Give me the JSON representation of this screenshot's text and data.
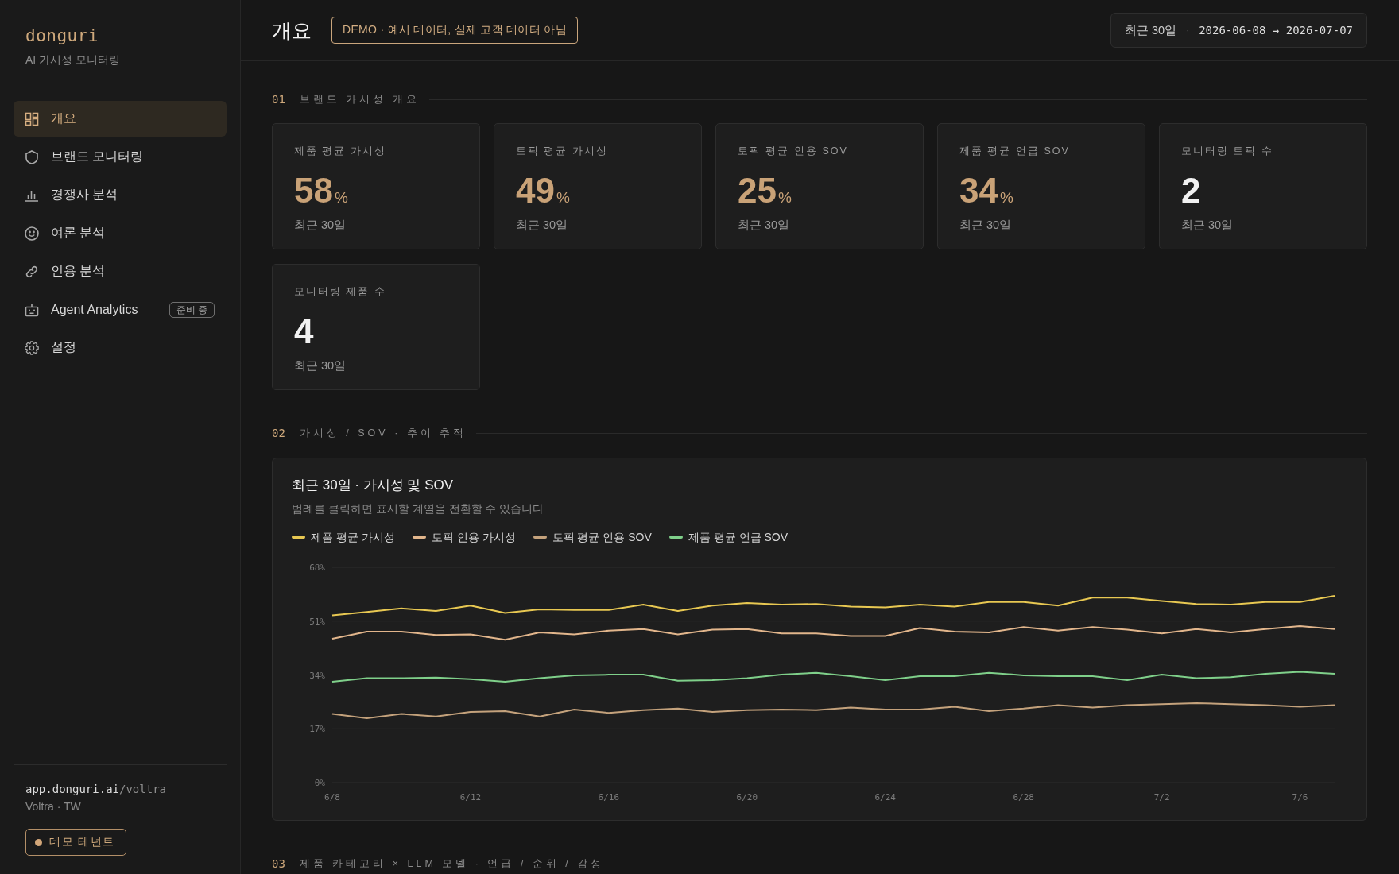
{
  "sidebar": {
    "logo": "donguri",
    "subtitle": "AI 가시성 모니터링",
    "nav_items": [
      {
        "label": "개요",
        "selected": true
      },
      {
        "label": "브랜드 모니터링",
        "selected": false
      },
      {
        "label": "경쟁사 분석",
        "selected": false
      },
      {
        "label": "여론 분석",
        "selected": false
      },
      {
        "label": "인용 분석",
        "selected": false
      },
      {
        "label": "Agent Analytics",
        "selected": false,
        "badge": "준비 중"
      },
      {
        "label": "설정",
        "selected": false
      }
    ],
    "footer": {
      "url_host": "app.donguri.ai",
      "url_path": "/voltra",
      "tenant": "Voltra · TW",
      "tenant_button": "데모 테넌트"
    }
  },
  "header": {
    "title": "개요",
    "demo_badge": "DEMO · 예시 데이터, 실제 고객 데이터 아님",
    "date_range": {
      "period": "최근 30일",
      "separator": "·",
      "range": "2026-06-08 → 2026-07-07"
    }
  },
  "sections": [
    {
      "number": "01",
      "title": "브랜드 가시성 개요",
      "metrics": [
        {
          "label": "제품 평균 가시성",
          "kind": "percent",
          "value": "58",
          "unit": "%",
          "caption": "최근 30일"
        },
        {
          "label": "토픽 평균 가시성",
          "kind": "percent",
          "value": "49",
          "unit": "%",
          "caption": "최근 30일"
        },
        {
          "label": "토픽 평균 인용 SOV",
          "kind": "percent",
          "value": "25",
          "unit": "%",
          "caption": "최근 30일"
        },
        {
          "label": "제품 평균 언급 SOV",
          "kind": "percent",
          "value": "34",
          "unit": "%",
          "caption": "최근 30일"
        },
        {
          "label": "모니터링 토픽 수",
          "kind": "count",
          "value": "2",
          "caption": "최근 30일"
        },
        {
          "label": "모니터링 제품 수",
          "kind": "count",
          "value": "4",
          "caption": "최근 30일"
        }
      ]
    },
    {
      "number": "02",
      "title": "가시성 / SOV · 추이 추적",
      "chart": {
        "hint": "범례를 클릭하면 표시할 계열을 전환할 수 있습니다",
        "chart_data": {
          "type": "line",
          "title": "최근 30일 · 가시성 및 SOV",
          "grid": true,
          "categories": [
            "6/8",
            null,
            null,
            null,
            "6/12",
            null,
            null,
            null,
            "6/16",
            null,
            null,
            null,
            "6/20",
            null,
            null,
            null,
            "6/24",
            null,
            null,
            null,
            "6/28",
            null,
            null,
            null,
            "7/2",
            null,
            null,
            null,
            "7/6",
            null
          ],
          "ylim": [
            0,
            68
          ],
          "yticks": [
            {
              "value": 0,
              "label": "0%"
            },
            {
              "value": 17,
              "label": "17%"
            },
            {
              "value": 34,
              "label": "34%"
            },
            {
              "value": 51,
              "label": "51%"
            },
            {
              "value": 68,
              "label": "68%"
            }
          ],
          "series": [
            {
              "name": "제품 평균 가시성",
              "color": "#e8c852",
              "values": [
                52.8,
                53.9,
                55.0,
                54.2,
                55.9,
                53.6,
                54.7,
                54.5,
                54.5,
                56.2,
                54.2,
                55.9,
                56.7,
                56.2,
                56.4,
                55.6,
                55.3,
                56.2,
                55.6,
                57.0,
                57.0,
                55.9,
                58.4,
                58.4,
                57.3,
                56.4,
                56.2,
                57.0,
                57.0,
                59.0
              ]
            },
            {
              "name": "토픽 인용 가시성",
              "color": "#e2b68c",
              "values": [
                45.4,
                47.7,
                47.7,
                46.6,
                46.8,
                45.1,
                47.4,
                46.8,
                48.0,
                48.5,
                46.8,
                48.3,
                48.5,
                47.1,
                47.1,
                46.3,
                46.3,
                48.8,
                47.7,
                47.4,
                49.1,
                48.0,
                49.1,
                48.3,
                47.1,
                48.5,
                47.4,
                48.5,
                49.4,
                48.5
              ]
            },
            {
              "name": "토픽 평균 인용 SOV",
              "color": "#c4a27c",
              "values": [
                21.7,
                20.3,
                21.7,
                20.9,
                22.3,
                22.6,
                20.9,
                23.1,
                22.0,
                22.9,
                23.4,
                22.3,
                22.9,
                23.1,
                22.9,
                23.7,
                23.1,
                23.1,
                24.0,
                22.6,
                23.4,
                24.5,
                23.7,
                24.5,
                24.8,
                25.1,
                24.8,
                24.5,
                24.0,
                24.5
              ]
            },
            {
              "name": "제품 평균 언급 SOV",
              "color": "#7fd08a",
              "values": [
                31.9,
                33.0,
                33.0,
                33.2,
                32.7,
                31.9,
                33.0,
                33.9,
                34.1,
                34.1,
                32.2,
                32.4,
                33.0,
                34.1,
                34.7,
                33.6,
                32.4,
                33.6,
                33.6,
                34.7,
                33.9,
                33.6,
                33.6,
                32.4,
                34.1,
                33.0,
                33.3,
                34.4,
                35.0,
                34.4
              ]
            }
          ]
        }
      }
    },
    {
      "number": "03",
      "title": "제품 카테고리 × LLM 모델 · 언급 / 순위 / 감성"
    }
  ]
}
